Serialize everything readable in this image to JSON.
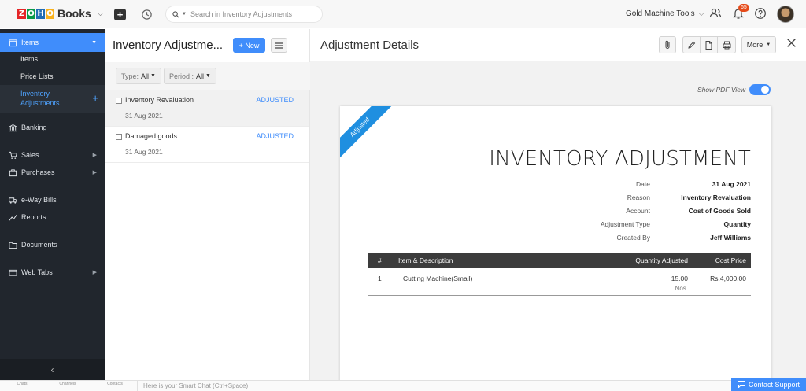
{
  "app": {
    "logo_letters": [
      "Z",
      "O",
      "H",
      "O"
    ],
    "logo_colors": [
      "#e42527",
      "#089949",
      "#226db4",
      "#f9b21d"
    ],
    "product": "Books",
    "search_placeholder": "Search in Inventory Adjustments",
    "org_name": "Gold Machine Tools",
    "notification_count": "65"
  },
  "sidebar": {
    "items_label": "Items",
    "sub_items": [
      "Items",
      "Price Lists"
    ],
    "active_sub_line1": "Inventory",
    "active_sub_line2": "Adjustments",
    "nav": [
      {
        "label": "Banking",
        "icon": "bank-icon"
      },
      {
        "label": "Sales",
        "icon": "cart-icon"
      },
      {
        "label": "Purchases",
        "icon": "bag-icon"
      },
      {
        "label": "e-Way Bills",
        "icon": "truck-icon"
      },
      {
        "label": "Reports",
        "icon": "chart-icon"
      },
      {
        "label": "Documents",
        "icon": "folder-icon"
      },
      {
        "label": "Web Tabs",
        "icon": "tabs-icon"
      }
    ],
    "collapse": "‹"
  },
  "list": {
    "title": "Inventory Adjustme...",
    "new_label": "+ New",
    "filter_type_label": "Type:",
    "filter_type_value": "All",
    "filter_period_label": "Period :",
    "filter_period_value": "All",
    "rows": [
      {
        "name": "Inventory Revaluation",
        "date": "31 Aug 2021",
        "status": "ADJUSTED"
      },
      {
        "name": "Damaged goods",
        "date": "31 Aug 2021",
        "status": "ADJUSTED"
      }
    ]
  },
  "detail": {
    "title": "Adjustment Details",
    "more_label": "More",
    "show_pdf_label": "Show PDF View",
    "ribbon": "Adjusted",
    "doc_title": "INVENTORY ADJUSTMENT",
    "meta": [
      {
        "key": "Date",
        "value": "31 Aug 2021"
      },
      {
        "key": "Reason",
        "value": "Inventory Revaluation"
      },
      {
        "key": "Account",
        "value": "Cost of Goods Sold"
      },
      {
        "key": "Adjustment Type",
        "value": "Quantity"
      },
      {
        "key": "Created By",
        "value": "Jeff Williams"
      }
    ],
    "table": {
      "headers": [
        "#",
        "Item & Description",
        "Quantity Adjusted",
        "Cost Price"
      ],
      "rows": [
        {
          "num": "1",
          "item": "Cutting Machine(Small)",
          "qty": "15.00",
          "unit": "Nos.",
          "cost": "Rs.4,000.00"
        }
      ]
    }
  },
  "bottom": {
    "tabs": [
      "Chats",
      "Channels",
      "Contacts"
    ],
    "chat_placeholder": "Here is your Smart Chat (Ctrl+Space)",
    "support_label": "Contact Support"
  }
}
